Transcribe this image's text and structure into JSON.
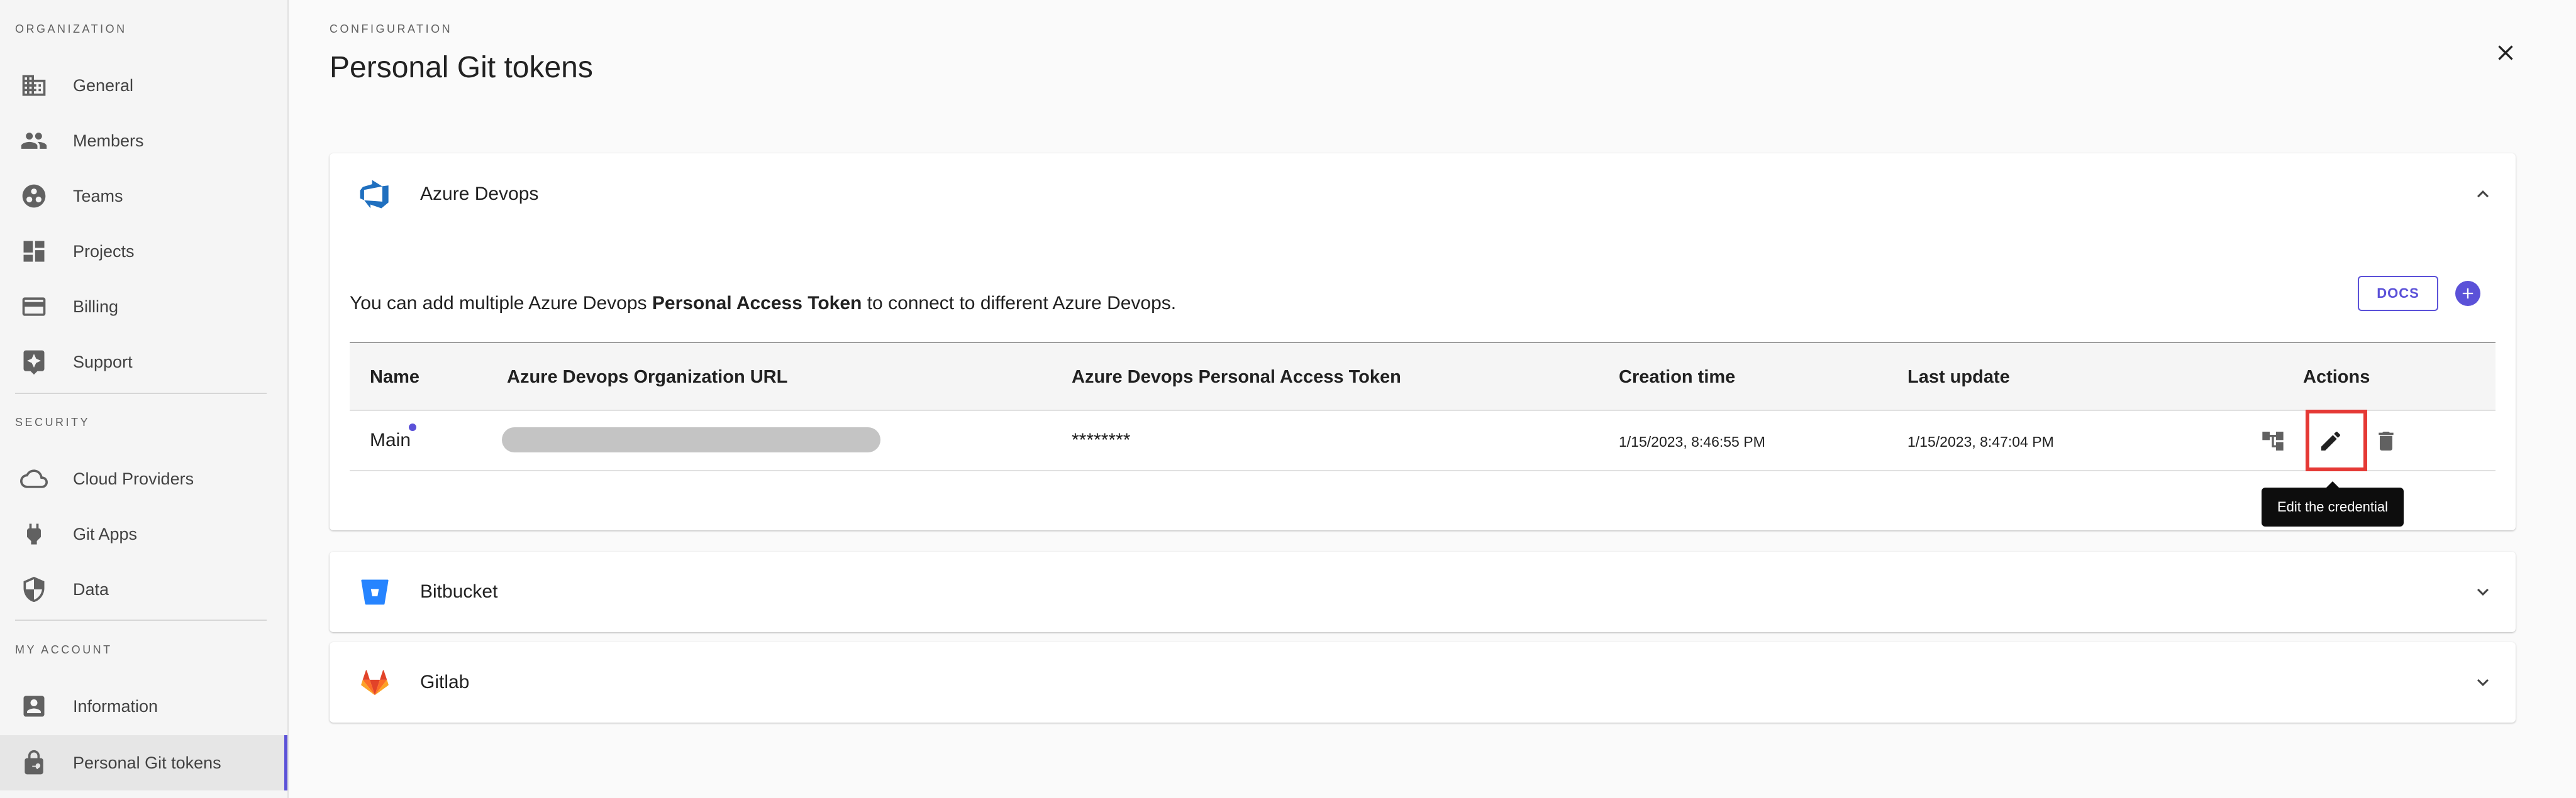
{
  "sidebar": {
    "sections": [
      {
        "label": "ORGANIZATION"
      },
      {
        "label": "SECURITY"
      },
      {
        "label": "MY ACCOUNT"
      }
    ],
    "items": [
      {
        "label": "General",
        "icon": "building-icon"
      },
      {
        "label": "Members",
        "icon": "people-icon"
      },
      {
        "label": "Teams",
        "icon": "teams-icon"
      },
      {
        "label": "Projects",
        "icon": "dashboard-icon"
      },
      {
        "label": "Billing",
        "icon": "credit-card-icon"
      },
      {
        "label": "Support",
        "icon": "support-icon"
      },
      {
        "label": "Cloud Providers",
        "icon": "cloud-icon"
      },
      {
        "label": "Git Apps",
        "icon": "plug-icon"
      },
      {
        "label": "Data",
        "icon": "shield-icon"
      },
      {
        "label": "Information",
        "icon": "account-box-icon"
      },
      {
        "label": "Personal Git tokens",
        "icon": "lock-key-icon",
        "active": true
      }
    ]
  },
  "header": {
    "crumb": "CONFIGURATION",
    "title": "Personal Git tokens"
  },
  "panels": [
    {
      "title": "Azure Devops",
      "expanded": true,
      "description_prefix": "You can add multiple Azure Devops ",
      "description_bold": "Personal Access Token",
      "description_suffix": " to connect to different Azure Devops.",
      "docs_label": "DOCS",
      "table": {
        "headers": [
          "Name",
          "Azure Devops Organization URL",
          "Azure Devops Personal Access Token",
          "Creation time",
          "Last update",
          "Actions"
        ],
        "rows": [
          {
            "name": "Main",
            "url": "",
            "token": "********",
            "created": "1/15/2023, 8:46:55 PM",
            "updated": "1/15/2023, 8:47:04 PM"
          }
        ]
      },
      "tooltip": "Edit the credential"
    },
    {
      "title": "Bitbucket",
      "expanded": false
    },
    {
      "title": "Gitlab",
      "expanded": false
    }
  ],
  "colors": {
    "accent": "#5b51d8",
    "highlight": "#e53935",
    "azure": "#1f6fbf",
    "bitbucket": "#2684ff",
    "gitlab": "#e24329"
  }
}
